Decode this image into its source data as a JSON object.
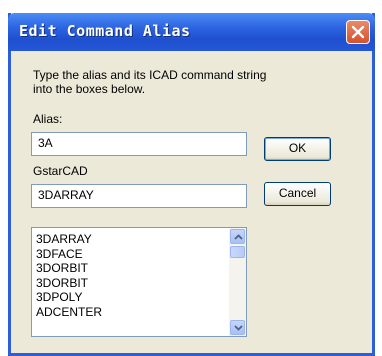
{
  "window": {
    "title": "Edit Command Alias"
  },
  "dialog": {
    "instructions": "Type the alias and its ICAD command string into the boxes below.",
    "alias_label": "Alias:",
    "alias_value": "3A",
    "command_label": "GstarCAD",
    "command_value": "3DARRAY",
    "ok_label": "OK",
    "cancel_label": "Cancel",
    "commands": [
      "3DARRAY",
      "3DFACE",
      "3DORBIT",
      "3DORBIT",
      "3DPOLY",
      "ADCENTER"
    ]
  },
  "icons": {
    "close": "close-icon",
    "scroll_up": "chevron-up-icon",
    "scroll_down": "chevron-down-icon"
  },
  "colors": {
    "titlebar": "#2b63e0",
    "close_button": "#d4522c",
    "dialog_bg": "#ece9d8"
  }
}
